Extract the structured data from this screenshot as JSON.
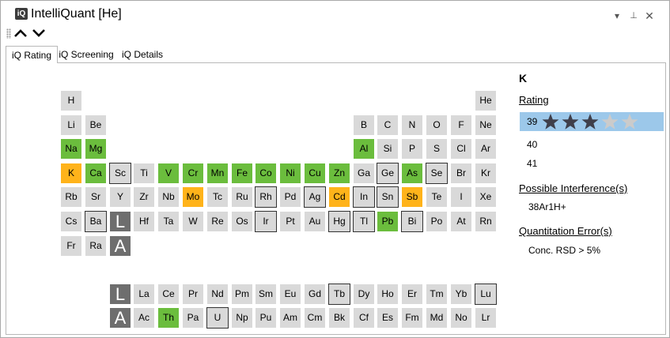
{
  "window": {
    "title": "IntelliQuant [He]",
    "app_icon_text": "iQ",
    "menu_glyph": "▾",
    "pin_glyph": "⊥",
    "close_glyph": "✕"
  },
  "tabs": [
    {
      "label": "iQ Rating",
      "active": true
    },
    {
      "label": "iQ Screening",
      "active": false
    },
    {
      "label": "iQ Details",
      "active": false
    }
  ],
  "colors": {
    "green": "#6bbd3d",
    "orange": "#ffb31a",
    "gray": "#d9d9d9",
    "dark": "#6e6e6e",
    "selection": "#9cc8ea",
    "star_filled": "#3f3f4a",
    "star_empty": "#cbcbcb"
  },
  "periodic_table": {
    "rows": [
      [
        {
          "s": "H",
          "c": 1
        },
        {
          "s": "He",
          "c": 18
        }
      ],
      [
        {
          "s": "Li",
          "c": 1
        },
        {
          "s": "Be",
          "c": 2
        },
        {
          "s": "B",
          "c": 13
        },
        {
          "s": "C",
          "c": 14
        },
        {
          "s": "N",
          "c": 15
        },
        {
          "s": "O",
          "c": 16
        },
        {
          "s": "F",
          "c": 17
        },
        {
          "s": "Ne",
          "c": 18
        }
      ],
      [
        {
          "s": "Na",
          "c": 1,
          "st": "green"
        },
        {
          "s": "Mg",
          "c": 2,
          "st": "green"
        },
        {
          "s": "Al",
          "c": 13,
          "st": "green"
        },
        {
          "s": "Si",
          "c": 14
        },
        {
          "s": "P",
          "c": 15
        },
        {
          "s": "S",
          "c": 16
        },
        {
          "s": "Cl",
          "c": 17
        },
        {
          "s": "Ar",
          "c": 18
        }
      ],
      [
        {
          "s": "K",
          "c": 1,
          "st": "orange"
        },
        {
          "s": "Ca",
          "c": 2,
          "st": "green"
        },
        {
          "s": "Sc",
          "c": 3,
          "b": 1
        },
        {
          "s": "Ti",
          "c": 4
        },
        {
          "s": "V",
          "c": 5,
          "st": "green"
        },
        {
          "s": "Cr",
          "c": 6,
          "st": "green"
        },
        {
          "s": "Mn",
          "c": 7,
          "st": "green"
        },
        {
          "s": "Fe",
          "c": 8,
          "st": "green"
        },
        {
          "s": "Co",
          "c": 9,
          "st": "green"
        },
        {
          "s": "Ni",
          "c": 10,
          "st": "green"
        },
        {
          "s": "Cu",
          "c": 11,
          "st": "green"
        },
        {
          "s": "Zn",
          "c": 12,
          "st": "green"
        },
        {
          "s": "Ga",
          "c": 13
        },
        {
          "s": "Ge",
          "c": 14,
          "b": 1
        },
        {
          "s": "As",
          "c": 15,
          "st": "green"
        },
        {
          "s": "Se",
          "c": 16,
          "b": 1
        },
        {
          "s": "Br",
          "c": 17
        },
        {
          "s": "Kr",
          "c": 18
        }
      ],
      [
        {
          "s": "Rb",
          "c": 1
        },
        {
          "s": "Sr",
          "c": 2
        },
        {
          "s": "Y",
          "c": 3
        },
        {
          "s": "Zr",
          "c": 4
        },
        {
          "s": "Nb",
          "c": 5
        },
        {
          "s": "Mo",
          "c": 6,
          "st": "orange"
        },
        {
          "s": "Tc",
          "c": 7
        },
        {
          "s": "Ru",
          "c": 8
        },
        {
          "s": "Rh",
          "c": 9,
          "b": 1
        },
        {
          "s": "Pd",
          "c": 10
        },
        {
          "s": "Ag",
          "c": 11,
          "b": 1
        },
        {
          "s": "Cd",
          "c": 12,
          "st": "orange"
        },
        {
          "s": "In",
          "c": 13,
          "b": 1
        },
        {
          "s": "Sn",
          "c": 14,
          "b": 1
        },
        {
          "s": "Sb",
          "c": 15,
          "st": "orange"
        },
        {
          "s": "Te",
          "c": 16
        },
        {
          "s": "I",
          "c": 17
        },
        {
          "s": "Xe",
          "c": 18
        }
      ],
      [
        {
          "s": "Cs",
          "c": 1
        },
        {
          "s": "Ba",
          "c": 2,
          "b": 1
        },
        {
          "s": "L",
          "c": 3,
          "st": "dark"
        },
        {
          "s": "Hf",
          "c": 4
        },
        {
          "s": "Ta",
          "c": 5
        },
        {
          "s": "W",
          "c": 6
        },
        {
          "s": "Re",
          "c": 7
        },
        {
          "s": "Os",
          "c": 8
        },
        {
          "s": "Ir",
          "c": 9,
          "b": 1
        },
        {
          "s": "Pt",
          "c": 10
        },
        {
          "s": "Au",
          "c": 11
        },
        {
          "s": "Hg",
          "c": 12,
          "b": 1
        },
        {
          "s": "Tl",
          "c": 13,
          "b": 1
        },
        {
          "s": "Pb",
          "c": 14,
          "st": "green"
        },
        {
          "s": "Bi",
          "c": 15,
          "b": 1
        },
        {
          "s": "Po",
          "c": 16
        },
        {
          "s": "At",
          "c": 17
        },
        {
          "s": "Rn",
          "c": 18
        }
      ],
      [
        {
          "s": "Fr",
          "c": 1
        },
        {
          "s": "Ra",
          "c": 2
        },
        {
          "s": "A",
          "c": 3,
          "st": "dark"
        }
      ],
      [],
      [
        {
          "s": "L",
          "c": 3,
          "st": "dark"
        },
        {
          "s": "La",
          "c": 4
        },
        {
          "s": "Ce",
          "c": 5
        },
        {
          "s": "Pr",
          "c": 6
        },
        {
          "s": "Nd",
          "c": 7
        },
        {
          "s": "Pm",
          "c": 8
        },
        {
          "s": "Sm",
          "c": 9
        },
        {
          "s": "Eu",
          "c": 10
        },
        {
          "s": "Gd",
          "c": 11
        },
        {
          "s": "Tb",
          "c": 12,
          "b": 1
        },
        {
          "s": "Dy",
          "c": 13
        },
        {
          "s": "Ho",
          "c": 14
        },
        {
          "s": "Er",
          "c": 15
        },
        {
          "s": "Tm",
          "c": 16
        },
        {
          "s": "Yb",
          "c": 17
        },
        {
          "s": "Lu",
          "c": 18,
          "b": 1
        }
      ],
      [
        {
          "s": "A",
          "c": 3,
          "st": "dark"
        },
        {
          "s": "Ac",
          "c": 4
        },
        {
          "s": "Th",
          "c": 5,
          "st": "green"
        },
        {
          "s": "Pa",
          "c": 6
        },
        {
          "s": "U",
          "c": 7,
          "b": 1
        },
        {
          "s": "Np",
          "c": 8
        },
        {
          "s": "Pu",
          "c": 9
        },
        {
          "s": "Am",
          "c": 10
        },
        {
          "s": "Cm",
          "c": 11
        },
        {
          "s": "Bk",
          "c": 12
        },
        {
          "s": "Cf",
          "c": 13
        },
        {
          "s": "Es",
          "c": 14
        },
        {
          "s": "Fm",
          "c": 15
        },
        {
          "s": "Md",
          "c": 16
        },
        {
          "s": "No",
          "c": 17
        },
        {
          "s": "Lr",
          "c": 18
        }
      ]
    ]
  },
  "panel": {
    "element": "K",
    "rating_heading": "Rating",
    "ratings": [
      {
        "mass": "39",
        "stars": 3,
        "max_stars": 5,
        "selected": true
      },
      {
        "mass": "40",
        "selected": false
      },
      {
        "mass": "41",
        "selected": false
      }
    ],
    "interference_heading": "Possible Interference(s)",
    "interference": "38Ar1H+",
    "error_heading": "Quantitation Error(s)",
    "error": "Conc. RSD > 5%"
  }
}
